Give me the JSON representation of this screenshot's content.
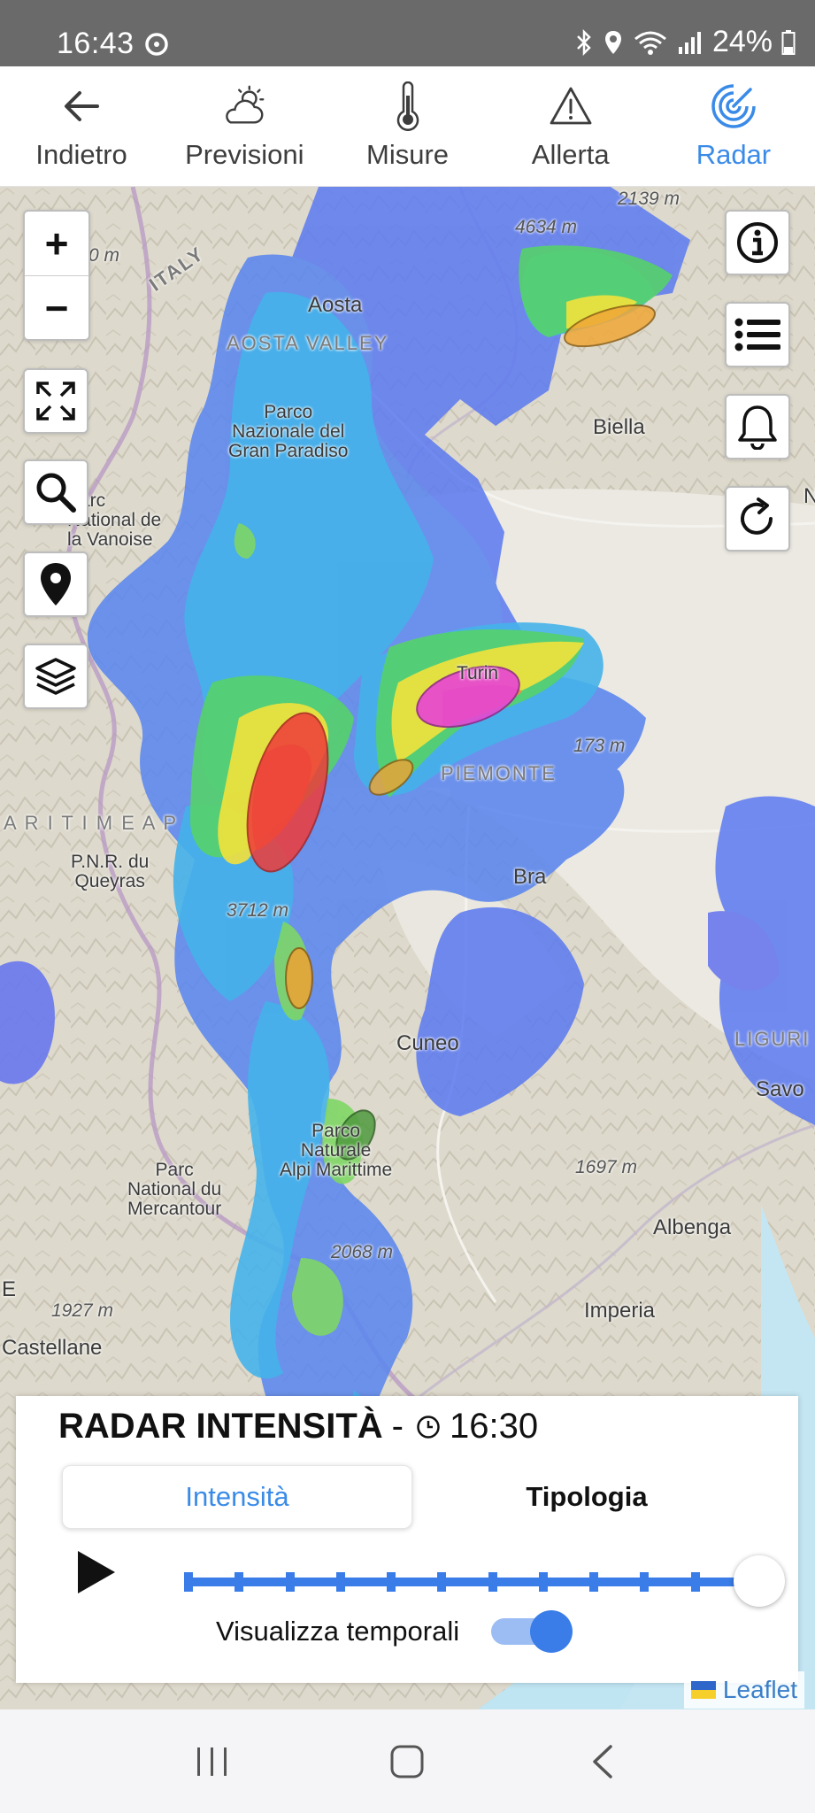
{
  "status_bar": {
    "time": "16:43",
    "battery": "24%"
  },
  "nav": {
    "items": [
      {
        "label": "Indietro",
        "icon": "back-arrow-icon",
        "active": false
      },
      {
        "label": "Previsioni",
        "icon": "weather-forecast-icon",
        "active": false
      },
      {
        "label": "Misure",
        "icon": "thermometer-icon",
        "active": false
      },
      {
        "label": "Allerta",
        "icon": "warning-icon",
        "active": false
      },
      {
        "label": "Radar",
        "icon": "radar-icon",
        "active": true
      }
    ],
    "active_color": "#3a8be8"
  },
  "map": {
    "zoom_in": "+",
    "zoom_out": "−",
    "labels": {
      "aosta": "Aosta",
      "aosta_valley": "AOSTA VALLEY",
      "italy": "ITALY",
      "biella": "Biella",
      "gran_paradiso": "Parco\nNazionale del\nGran Paradiso",
      "vanoise": "Parc\nNational de\nla Vanoise",
      "torino": "Turin",
      "piemonte": "PIEMONTE",
      "bra": "Bra",
      "queyras": "P.N.R. du\nQueyras",
      "alpes": "A R I T I M E   A P",
      "cuneo": "Cuneo",
      "liguria": "LIGURI",
      "savona": "Savo",
      "mercantour": "Parc\nNational du\nMercantour",
      "alpi_marittime": "Parco\nNaturale\nAlpi Marittime",
      "albenga": "Albenga",
      "imperia": "Imperia",
      "castellane": "Castellane",
      "elev_2139": "2139 m",
      "elev_4634": "4634 m",
      "elev_0": "0 m",
      "elev_173": "173 m",
      "elev_3712": "3712 m",
      "elev_1697": "1697 m",
      "elev_2068": "2068 m",
      "elev_1927": "1927 m",
      "edge_n": "N",
      "edge_e": "E"
    },
    "attribution": "Leaflet"
  },
  "radar_card": {
    "title": "RADAR INTENSITÀ",
    "separator": "-",
    "time": "16:30",
    "tabs": [
      {
        "label": "Intensità",
        "active": true
      },
      {
        "label": "Tipologia",
        "active": false
      }
    ],
    "timeline_position": 1.0,
    "timeline_steps": 12,
    "toggle_label": "Visualizza temporali",
    "toggle_on": true,
    "accent": "#3a7de8"
  }
}
